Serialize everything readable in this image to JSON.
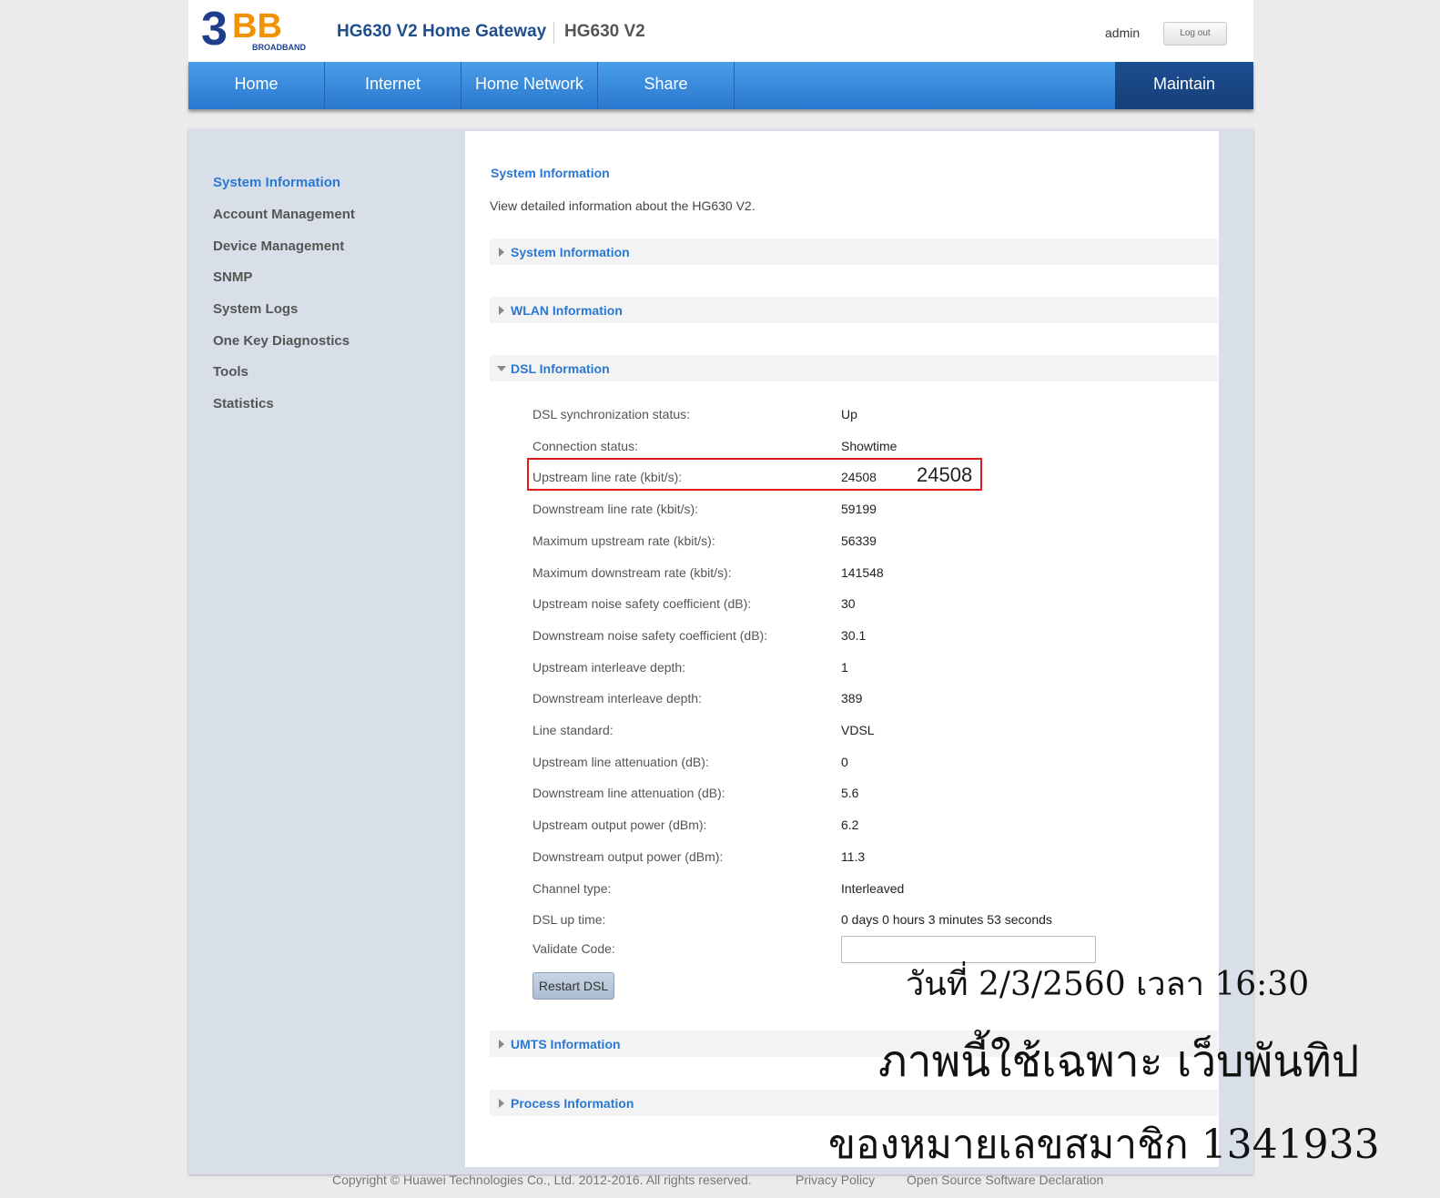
{
  "header": {
    "brand_text": "BROADBAND",
    "brand_number": "3",
    "brand_letters": "BB",
    "gateway_title": "HG630 V2 Home Gateway",
    "model": "HG630 V2",
    "username": "admin",
    "logout_label": "Log out"
  },
  "nav": {
    "items": [
      "Home",
      "Internet",
      "Home Network",
      "Share"
    ],
    "active": "Maintain"
  },
  "sidebar": {
    "items": [
      "System Information",
      "Account Management",
      "Device Management",
      "SNMP",
      "System Logs",
      "One Key Diagnostics",
      "Tools",
      "Statistics"
    ],
    "active_index": 0
  },
  "main": {
    "heading": "System Information",
    "description": "View detailed information about the HG630 V2.",
    "sections": [
      "System Information",
      "WLAN Information",
      "DSL Information",
      "UMTS Information",
      "Process Information"
    ],
    "dsl_rows": [
      {
        "label": "DSL synchronization status:",
        "value": "Up"
      },
      {
        "label": "Connection status:",
        "value": "Showtime"
      },
      {
        "label": "Upstream line rate (kbit/s):",
        "value": "24508"
      },
      {
        "label": "Downstream line rate (kbit/s):",
        "value": "59199"
      },
      {
        "label": "Maximum upstream rate (kbit/s):",
        "value": "56339"
      },
      {
        "label": "Maximum downstream rate (kbit/s):",
        "value": "141548"
      },
      {
        "label": "Upstream noise safety coefficient (dB):",
        "value": "30"
      },
      {
        "label": "Downstream noise safety coefficient (dB):",
        "value": "30.1"
      },
      {
        "label": "Upstream interleave depth:",
        "value": "1"
      },
      {
        "label": "Downstream interleave depth:",
        "value": "389"
      },
      {
        "label": "Line standard:",
        "value": "VDSL"
      },
      {
        "label": "Upstream line attenuation (dB):",
        "value": "0"
      },
      {
        "label": "Downstream line attenuation (dB):",
        "value": "5.6"
      },
      {
        "label": "Upstream output power (dBm):",
        "value": "6.2"
      },
      {
        "label": "Downstream output power (dBm):",
        "value": "11.3"
      },
      {
        "label": "Channel type:",
        "value": "Interleaved"
      },
      {
        "label": "DSL up time:",
        "value": "0 days 0 hours 3 minutes 53 seconds"
      }
    ],
    "validate_label": "Validate Code:",
    "validate_value": "",
    "restart_label": "Restart DSL",
    "highlight_value": "24508"
  },
  "footer": {
    "copyright": "Copyright © Huawei Technologies Co., Ltd. 2012-2016. All rights reserved.",
    "privacy": "Privacy Policy",
    "open_source": "Open Source Software Declaration"
  },
  "overlay": {
    "line1": "วันที่ 2/3/2560 เวลา 16:30",
    "line2": "ภาพนี้ใช้เฉพาะ เว็บพันทิป",
    "line3": "ของหมายเลขสมาชิก 1341933"
  },
  "colors": {
    "accent": "#2b78d2",
    "nav_blue": "#2a77cf",
    "nav_active": "#1d4e91",
    "brand_orange": "#f39200",
    "brand_navy": "#1f3f8c",
    "highlight_red": "#e01b1b"
  }
}
